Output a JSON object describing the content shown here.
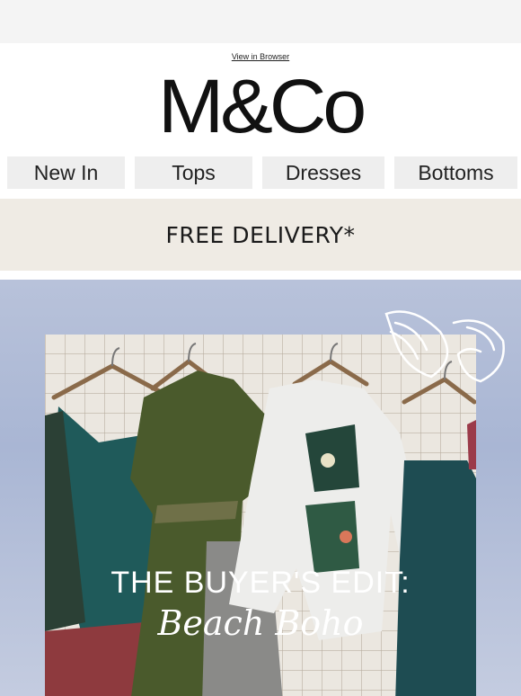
{
  "header": {
    "view_in_browser": "View in Browser",
    "logo_text": "M&Co"
  },
  "nav": {
    "items": [
      {
        "label": "New In"
      },
      {
        "label": "Tops"
      },
      {
        "label": "Dresses"
      },
      {
        "label": "Bottoms"
      }
    ]
  },
  "promo": {
    "text": "FREE DELIVERY*"
  },
  "hero": {
    "headline": "THE BUYER'S EDIT:",
    "script_title": "Beach Boho",
    "decoration_icon": "seashell-icon"
  },
  "colors": {
    "promo_bg": "#efebe4",
    "nav_bg": "#eeeeee",
    "hero_bg": "#aeb9d6"
  }
}
